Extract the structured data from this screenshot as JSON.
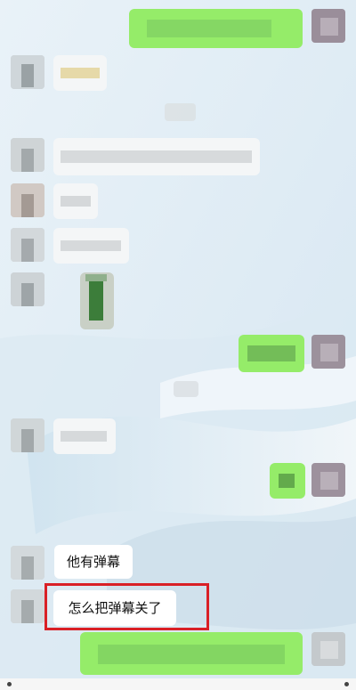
{
  "chat": {
    "messages": [
      {
        "sender": "other",
        "text": "他有弹幕"
      },
      {
        "sender": "other",
        "text": "怎么把弹幕关了",
        "highlighted": true
      }
    ]
  },
  "colors": {
    "outgoing_bubble": "#95ec69",
    "incoming_bubble": "#ffffff",
    "highlight_box": "#d92026",
    "background": "#e6f0f6"
  }
}
